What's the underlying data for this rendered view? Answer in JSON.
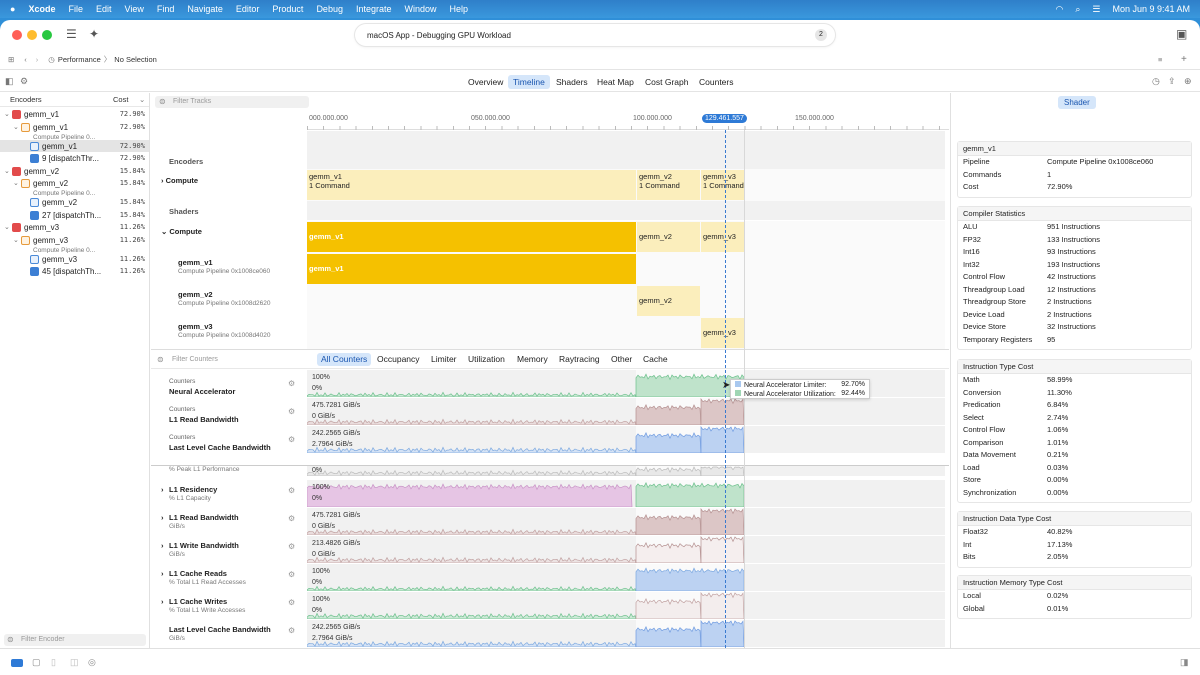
{
  "menubar": {
    "app": "Xcode",
    "items": [
      "File",
      "Edit",
      "View",
      "Find",
      "Navigate",
      "Editor",
      "Product",
      "Debug",
      "Integrate",
      "Window",
      "Help"
    ],
    "datetime": "Mon Jun 9  9:41 AM"
  },
  "window": {
    "title": "macOS App - Debugging GPU Workload",
    "badge": "2"
  },
  "jumpbar": {
    "item1": "Performance",
    "sep": "〉",
    "item2": "No Selection"
  },
  "tabs": [
    "Overview",
    "Timeline",
    "Shaders",
    "Heat Map",
    "Cost Graph",
    "Counters"
  ],
  "active_tab": "Timeline",
  "left": {
    "col_encoders": "Encoders",
    "col_cost": "Cost",
    "rows": [
      {
        "label": "gemm_v1",
        "cost": "72.90%",
        "icon": "red",
        "indent": 0,
        "chev": "⌄"
      },
      {
        "label": "gemm_v1",
        "cost": "72.90%",
        "icon": "org",
        "indent": 1,
        "chev": "⌄",
        "sub": "Compute Pipeline 0..."
      },
      {
        "label": "gemm_v1",
        "cost": "72.90%",
        "icon": "blu",
        "indent": 2,
        "chev": ""
      },
      {
        "label": "9 [dispatchThr...",
        "cost": "72.90%",
        "icon": "blu2",
        "indent": 2,
        "chev": ""
      },
      {
        "label": "gemm_v2",
        "cost": "15.84%",
        "icon": "red",
        "indent": 0,
        "chev": "⌄"
      },
      {
        "label": "gemm_v2",
        "cost": "15.84%",
        "icon": "org",
        "indent": 1,
        "chev": "⌄",
        "sub": "Compute Pipeline 0..."
      },
      {
        "label": "gemm_v2",
        "cost": "15.84%",
        "icon": "blu",
        "indent": 2,
        "chev": ""
      },
      {
        "label": "27 [dispatchTh...",
        "cost": "15.84%",
        "icon": "blu2",
        "indent": 2,
        "chev": ""
      },
      {
        "label": "gemm_v3",
        "cost": "11.26%",
        "icon": "red",
        "indent": 0,
        "chev": "⌄"
      },
      {
        "label": "gemm_v3",
        "cost": "11.26%",
        "icon": "org",
        "indent": 1,
        "chev": "⌄",
        "sub": "Compute Pipeline 0..."
      },
      {
        "label": "gemm_v3",
        "cost": "11.26%",
        "icon": "blu",
        "indent": 2,
        "chev": ""
      },
      {
        "label": "45 [dispatchTh...",
        "cost": "11.26%",
        "icon": "blu2",
        "indent": 2,
        "chev": ""
      }
    ],
    "filter_placeholder": "Filter Encoder"
  },
  "timeline": {
    "filter_tracks": "Filter Tracks",
    "ticks": [
      "000.000.000",
      "050.000.000",
      "100.000.000",
      "150.000.000"
    ],
    "cursor": "129.461.557",
    "encoders_header": "Encoders",
    "compute_label": "Compute",
    "shaders_header": "Shaders",
    "enc_bars": [
      {
        "name": "gemm_v1",
        "sub": "1 Command"
      },
      {
        "name": "gemm_v2",
        "sub": "1 Command"
      },
      {
        "name": "gemm_v3",
        "sub": "1 Command"
      }
    ],
    "shader_rows": [
      {
        "name": "gemm_v1",
        "sub": "Compute Pipeline 0x1008ce060"
      },
      {
        "name": "gemm_v2",
        "sub": "Compute Pipeline 0x1008d2620"
      },
      {
        "name": "gemm_v3",
        "sub": "Compute Pipeline 0x1008d4020"
      }
    ]
  },
  "counters": {
    "filter": "Filter Counters",
    "tabs": [
      "All Counters",
      "Occupancy",
      "Limiter",
      "Utilization",
      "Memory",
      "Raytracing",
      "Other",
      "Cache"
    ],
    "active_tab": "All Counters",
    "pinned": [
      {
        "cat": "Counters",
        "name": "Neural Accelerator",
        "top": "100%",
        "bottom": "0%"
      },
      {
        "cat": "Counters",
        "name": "L1 Read Bandwidth",
        "top": "475.7281 GiB/s",
        "bottom": "0 GiB/s"
      },
      {
        "cat": "Counters",
        "name": "Last Level Cache Bandwidth",
        "top": "242.2565 GiB/s",
        "bottom": "2.7964 GiB/s"
      }
    ],
    "partial": {
      "sub": "% Peak L1 Performance",
      "value": "0%"
    },
    "rows": [
      {
        "name": "L1 Residency",
        "sub": "% L1 Capacity",
        "top": "100%",
        "bottom": "0%"
      },
      {
        "name": "L1 Read Bandwidth",
        "sub": "GiB/s",
        "top": "475.7281 GiB/s",
        "bottom": "0 GiB/s"
      },
      {
        "name": "L1 Write Bandwidth",
        "sub": "GiB/s",
        "top": "213.4826 GiB/s",
        "bottom": "0 GiB/s"
      },
      {
        "name": "L1 Cache Reads",
        "sub": "% Total L1 Read Accesses",
        "top": "100%",
        "bottom": "0%"
      },
      {
        "name": "L1 Cache Writes",
        "sub": "% Total L1 Write Accesses",
        "top": "100%",
        "bottom": "0%"
      },
      {
        "name": "Last Level Cache Bandwidth",
        "sub": "GiB/s",
        "top": "242.2565 GiB/s",
        "bottom": "2.7964 GiB/s"
      }
    ],
    "tooltip": [
      {
        "label": "Neural Accelerator Limiter:",
        "value": "92.70%"
      },
      {
        "label": "Neural Accelerator Utilization:",
        "value": "92.44%"
      }
    ]
  },
  "inspector": {
    "tab": "Shader",
    "title": "gemm_v1",
    "summary": [
      {
        "k": "Pipeline",
        "v": "Compute Pipeline 0x1008ce060"
      },
      {
        "k": "Commands",
        "v": "1"
      },
      {
        "k": "Cost",
        "v": "72.90%"
      }
    ],
    "compiler_title": "Compiler Statistics",
    "compiler": [
      {
        "k": "ALU",
        "v": "951 Instructions"
      },
      {
        "k": "FP32",
        "v": "133 Instructions"
      },
      {
        "k": "Int16",
        "v": "93 Instructions"
      },
      {
        "k": "Int32",
        "v": "193 Instructions"
      },
      {
        "k": "Control Flow",
        "v": "42 Instructions"
      },
      {
        "k": "Threadgroup Load",
        "v": "12 Instructions"
      },
      {
        "k": "Threadgroup Store",
        "v": "2 Instructions"
      },
      {
        "k": "Device Load",
        "v": "2 Instructions"
      },
      {
        "k": "Device Store",
        "v": "32 Instructions"
      },
      {
        "k": "Temporary Registers",
        "v": "95"
      }
    ],
    "itype_title": "Instruction Type Cost",
    "itype": [
      {
        "k": "Math",
        "v": "58.99%"
      },
      {
        "k": "Conversion",
        "v": "11.30%"
      },
      {
        "k": "Predication",
        "v": "6.84%"
      },
      {
        "k": "Select",
        "v": "2.74%"
      },
      {
        "k": "Control Flow",
        "v": "1.06%"
      },
      {
        "k": "Comparison",
        "v": "1.01%"
      },
      {
        "k": "Data Movement",
        "v": "0.21%"
      },
      {
        "k": "Load",
        "v": "0.03%"
      },
      {
        "k": "Store",
        "v": "0.00%"
      },
      {
        "k": "Synchronization",
        "v": "0.00%"
      }
    ],
    "idata_title": "Instruction Data Type Cost",
    "idata": [
      {
        "k": "Float32",
        "v": "40.82%"
      },
      {
        "k": "Int",
        "v": "17.13%"
      },
      {
        "k": "Bits",
        "v": "2.05%"
      }
    ],
    "imem_title": "Instruction Memory Type Cost",
    "imem": [
      {
        "k": "Local",
        "v": "0.02%"
      },
      {
        "k": "Global",
        "v": "0.01%"
      }
    ]
  },
  "colors": {
    "accent": "#2e7ad6",
    "yellow": "#f5c100",
    "pale_yellow": "#fbeebc",
    "green": "#9fd6b4",
    "blue": "#a9c8ef",
    "purple": "#d7a7d6"
  }
}
